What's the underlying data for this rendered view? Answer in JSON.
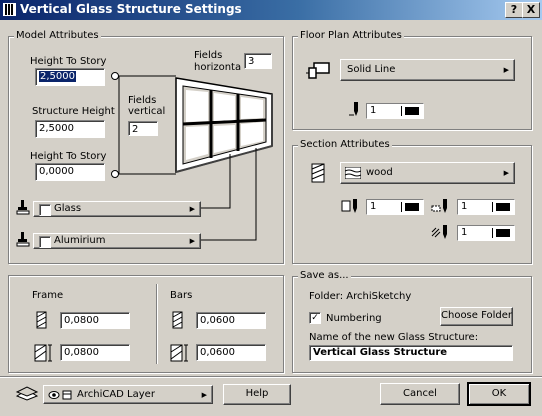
{
  "window": {
    "title": "Vertical Glass Structure Settings",
    "help_label": "?",
    "close_label": "X"
  },
  "model": {
    "group_label": "Model Attributes",
    "height_to_story_top_label": "Height To Story",
    "height_to_story_top_value": "2,5000",
    "structure_height_label": "Structure Height",
    "structure_height_value": "2,5000",
    "height_to_story_bottom_label": "Height To Story",
    "height_to_story_bottom_value": "0,0000",
    "fields_horizontal_label_line1": "Fields",
    "fields_horizontal_label_line2": "horizonta",
    "fields_horizontal_value": "3",
    "fields_vertical_label_line1": "Fields",
    "fields_vertical_label_line2": "vertical",
    "fields_vertical_value": "2",
    "glass_material": "Glass",
    "frame_material": "Alumirium"
  },
  "profiles": {
    "frame_label": "Frame",
    "frame_width": "0,0800",
    "frame_depth": "0,0800",
    "bars_label": "Bars",
    "bars_width": "0,0600",
    "bars_depth": "0,0600"
  },
  "floor_plan": {
    "group_label": "Floor Plan Attributes",
    "line_type": "Solid Line",
    "pen_number": "1"
  },
  "section": {
    "group_label": "Section Attributes",
    "fill": "wood",
    "pen1": "1",
    "pen2": "1",
    "pen3": "1"
  },
  "save": {
    "group_label": "Save as...",
    "folder_label": "Folder: ArchiSketchy",
    "numbering_label": "Numbering",
    "numbering_checked": true,
    "choose_folder_label": "Choose Folder",
    "name_label": "Name of the new Glass Structure:",
    "name_value": "Vertical Glass Structure"
  },
  "bottom": {
    "layer_name": "ArchiCAD Layer",
    "help_label": "Help",
    "cancel_label": "Cancel",
    "ok_label": "OK"
  }
}
